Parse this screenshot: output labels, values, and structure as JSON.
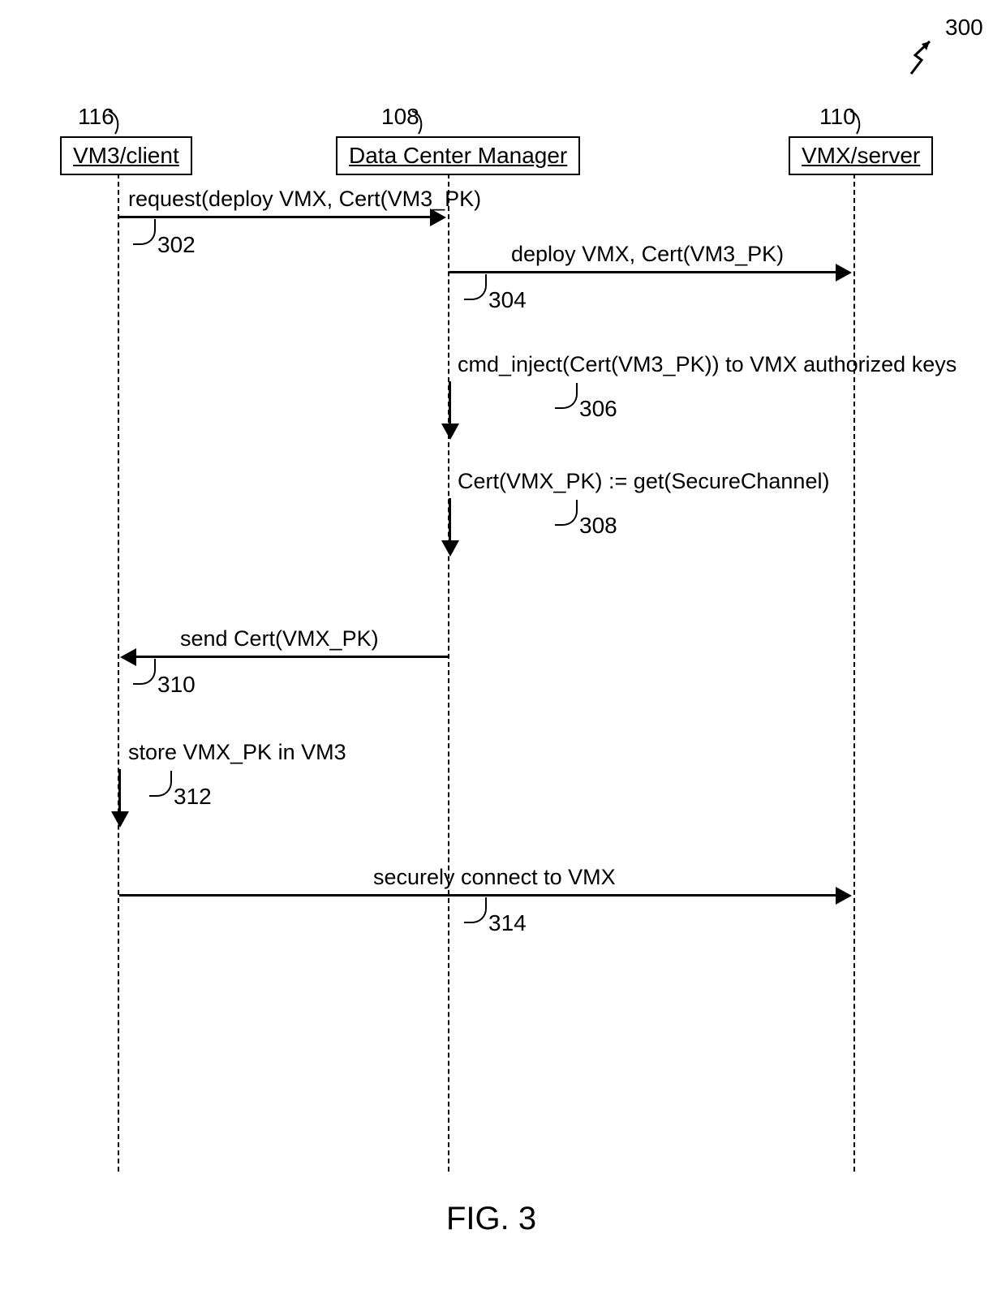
{
  "figure_ref": "300",
  "figure_label": "FIG. 3",
  "actors": {
    "vm3": {
      "ref": "116",
      "label": "VM3/client"
    },
    "dcm": {
      "ref": "108",
      "label": "Data Center Manager"
    },
    "vmx": {
      "ref": "110",
      "label": "VMX/server"
    }
  },
  "messages": {
    "m302": {
      "num": "302",
      "text": "request(deploy VMX, Cert(VM3_PK)"
    },
    "m304": {
      "num": "304",
      "text": "deploy VMX, Cert(VM3_PK)"
    },
    "m306": {
      "num": "306",
      "text": "cmd_inject(Cert(VM3_PK)) to VMX authorized keys"
    },
    "m308": {
      "num": "308",
      "text": "Cert(VMX_PK) := get(SecureChannel)"
    },
    "m310": {
      "num": "310",
      "text": "send Cert(VMX_PK)"
    },
    "m312": {
      "num": "312",
      "text": "store VMX_PK in VM3"
    },
    "m314": {
      "num": "314",
      "text": "securely connect to VMX"
    }
  }
}
